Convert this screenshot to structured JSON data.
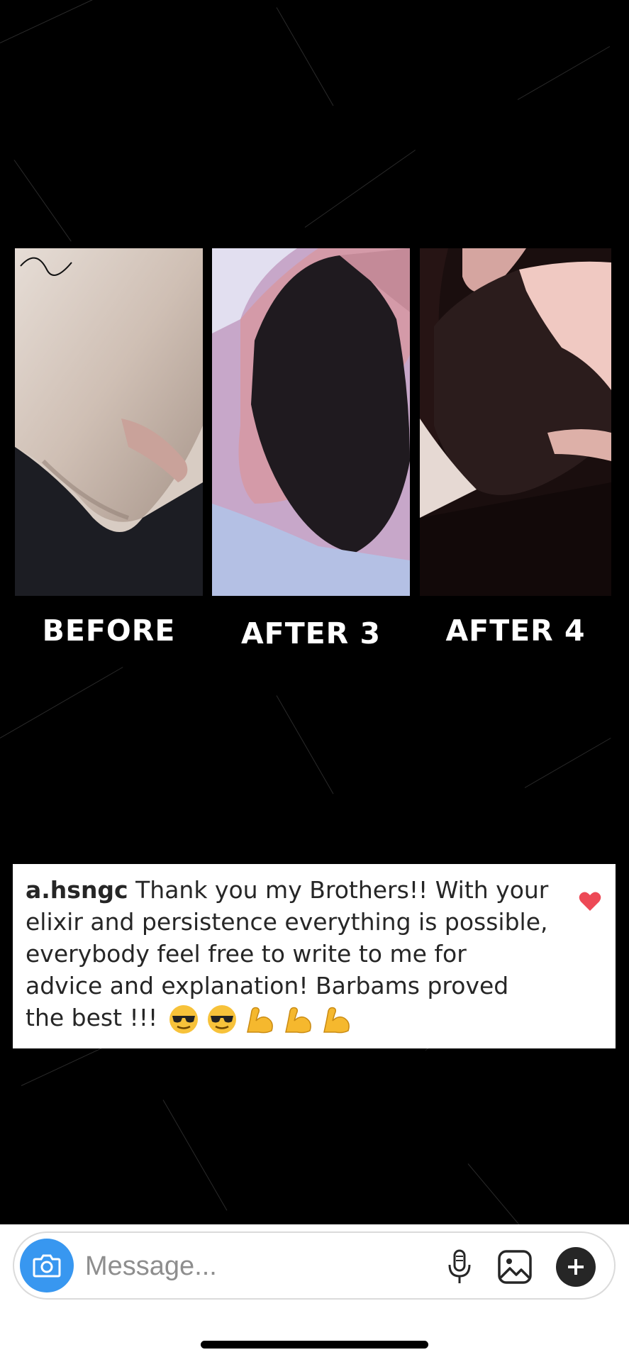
{
  "post": {
    "captions": [
      "BEFORE",
      "AFTER 3",
      "AFTER 4"
    ]
  },
  "comment": {
    "username": "a.hsngc",
    "text": "Thank you my Brothers!! With your elixir and persistence everything is possible, everybody feel free to write to me for advice and explanation! Barbams proved the best !!!",
    "emojis": [
      "smiling-face-with-sunglasses",
      "smiling-face-with-sunglasses",
      "flexed-biceps",
      "flexed-biceps",
      "flexed-biceps"
    ],
    "liked": true,
    "heart_color": "#ed4956"
  },
  "composer": {
    "placeholder": "Message...",
    "camera_icon": "camera-icon",
    "mic_icon": "microphone-icon",
    "gallery_icon": "gallery-icon",
    "plus_icon": "plus-icon",
    "accent": "#3897f0"
  },
  "colors": {
    "background": "#000000",
    "card": "#ffffff",
    "text": "#262626"
  }
}
